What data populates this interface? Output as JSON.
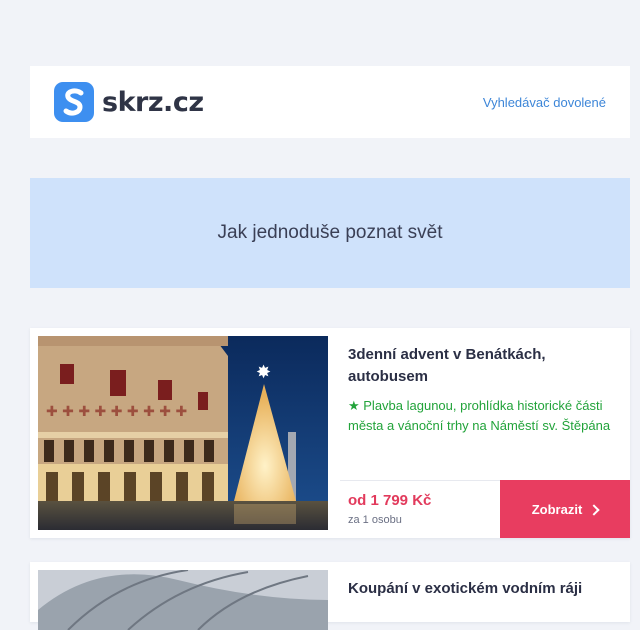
{
  "header": {
    "logo_text": "skrz.cz",
    "nav_link": "Vyhledávač dovolené"
  },
  "banner": {
    "title": "Jak jednoduše poznat svět"
  },
  "offers": [
    {
      "title": "3denní advent v Benátkách, autobusem",
      "highlight": "★ Plavba lagunou, prohlídka historické části města a vánoční trhy na Náměstí sv. Štěpána",
      "price": "od 1 799 Kč",
      "price_note": "za 1 osobu",
      "button_label": "Zobrazit"
    },
    {
      "title": "Koupání v exotickém vodním ráji"
    }
  ],
  "colors": {
    "brand": "#3d8ff0",
    "price": "#e23a5c",
    "button": "#e83d60",
    "highlight": "#22a33a",
    "banner": "#cfe2fb"
  }
}
